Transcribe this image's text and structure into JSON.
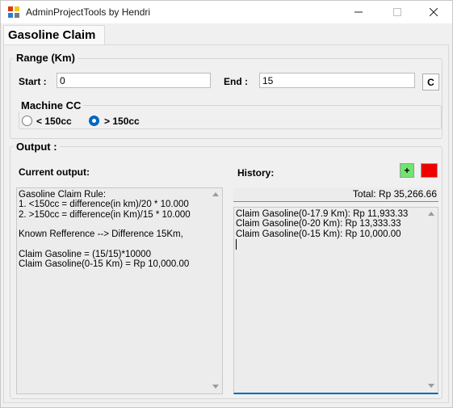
{
  "window": {
    "title": "AdminProjectTools by Hendri"
  },
  "tabs": [
    {
      "label": "Gasoline Claim"
    }
  ],
  "range": {
    "title": "Range (Km)",
    "start_label": "Start :",
    "start_value": "0",
    "end_label": "End :",
    "end_value": "15",
    "clear_label": "C"
  },
  "machine": {
    "title": "Machine CC",
    "options": [
      {
        "label": "< 150cc",
        "selected": false
      },
      {
        "label": "> 150cc",
        "selected": true
      }
    ]
  },
  "output": {
    "title": "Output :",
    "current_label": "Current output:",
    "current_text": "Gasoline Claim Rule:\n1. <150cc = difference(in km)/20 * 10.000\n2. >150cc = difference(in Km)/15 * 10.000\n\nKnown Refference --> Difference 15Km,\n\nClaim Gasoline = (15/15)*10000\nClaim Gasoline(0-15 Km) = Rp 10,000.00",
    "history_label": "History:",
    "add_label": "+",
    "total": "Total: Rp 35,266.66",
    "history_text": "Claim Gasoline(0-17.9 Km): Rp 11,933.33\nClaim Gasoline(0-20 Km): Rp 13,333.33\nClaim Gasoline(0-15 Km): Rp 10,000.00"
  },
  "colors": {
    "accent": "#0067c0",
    "add_button": "#6fe56f",
    "remove_button": "#ee0000"
  }
}
